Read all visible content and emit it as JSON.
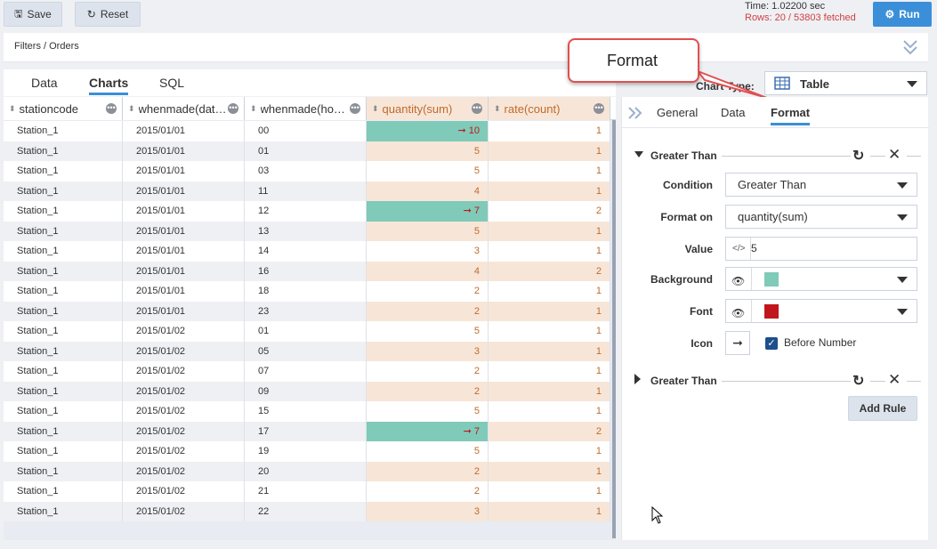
{
  "toolbar": {
    "save_label": "Save",
    "reset_label": "Reset",
    "run_label": "Run"
  },
  "status": {
    "time": "Time: 1.02200 sec",
    "rows": "Rows: 20 / 53803 fetched"
  },
  "breadcrumb": "Filters / Orders",
  "tabs": [
    "Data",
    "Charts",
    "SQL"
  ],
  "active_tab": "Charts",
  "chart_type": {
    "label": "Chart Type:",
    "value": "Table"
  },
  "callout": "Format",
  "columns": [
    "stationcode",
    "whenmade(dat…",
    "whenmade(ho…",
    "quantity(sum)",
    "rate(count)"
  ],
  "rows": [
    {
      "station": "Station_1",
      "date": "2015/01/01",
      "hour": "00",
      "qty": "10",
      "rate": "1",
      "hl": true
    },
    {
      "station": "Station_1",
      "date": "2015/01/01",
      "hour": "01",
      "qty": "5",
      "rate": "1",
      "hl": false
    },
    {
      "station": "Station_1",
      "date": "2015/01/01",
      "hour": "03",
      "qty": "5",
      "rate": "1",
      "hl": false
    },
    {
      "station": "Station_1",
      "date": "2015/01/01",
      "hour": "11",
      "qty": "4",
      "rate": "1",
      "hl": false
    },
    {
      "station": "Station_1",
      "date": "2015/01/01",
      "hour": "12",
      "qty": "7",
      "rate": "2",
      "hl": true
    },
    {
      "station": "Station_1",
      "date": "2015/01/01",
      "hour": "13",
      "qty": "5",
      "rate": "1",
      "hl": false
    },
    {
      "station": "Station_1",
      "date": "2015/01/01",
      "hour": "14",
      "qty": "3",
      "rate": "1",
      "hl": false
    },
    {
      "station": "Station_1",
      "date": "2015/01/01",
      "hour": "16",
      "qty": "4",
      "rate": "2",
      "hl": false
    },
    {
      "station": "Station_1",
      "date": "2015/01/01",
      "hour": "18",
      "qty": "2",
      "rate": "1",
      "hl": false
    },
    {
      "station": "Station_1",
      "date": "2015/01/01",
      "hour": "23",
      "qty": "2",
      "rate": "1",
      "hl": false
    },
    {
      "station": "Station_1",
      "date": "2015/01/02",
      "hour": "01",
      "qty": "5",
      "rate": "1",
      "hl": false
    },
    {
      "station": "Station_1",
      "date": "2015/01/02",
      "hour": "05",
      "qty": "3",
      "rate": "1",
      "hl": false
    },
    {
      "station": "Station_1",
      "date": "2015/01/02",
      "hour": "07",
      "qty": "2",
      "rate": "1",
      "hl": false
    },
    {
      "station": "Station_1",
      "date": "2015/01/02",
      "hour": "09",
      "qty": "2",
      "rate": "1",
      "hl": false
    },
    {
      "station": "Station_1",
      "date": "2015/01/02",
      "hour": "15",
      "qty": "5",
      "rate": "1",
      "hl": false
    },
    {
      "station": "Station_1",
      "date": "2015/01/02",
      "hour": "17",
      "qty": "7",
      "rate": "2",
      "hl": true
    },
    {
      "station": "Station_1",
      "date": "2015/01/02",
      "hour": "19",
      "qty": "5",
      "rate": "1",
      "hl": false
    },
    {
      "station": "Station_1",
      "date": "2015/01/02",
      "hour": "20",
      "qty": "2",
      "rate": "1",
      "hl": false
    },
    {
      "station": "Station_1",
      "date": "2015/01/02",
      "hour": "21",
      "qty": "2",
      "rate": "1",
      "hl": false
    },
    {
      "station": "Station_1",
      "date": "2015/01/02",
      "hour": "22",
      "qty": "3",
      "rate": "1",
      "hl": false
    }
  ],
  "panel": {
    "tabs": [
      "General",
      "Data",
      "Format"
    ],
    "active_tab": "Format",
    "rule1": {
      "title": "Greater Than"
    },
    "condition": {
      "label": "Condition",
      "value": "Greater Than"
    },
    "format_on": {
      "label": "Format on",
      "value": "quantity(sum)"
    },
    "value": {
      "label": "Value",
      "value": "5"
    },
    "background": {
      "label": "Background",
      "color": "#7fcab8"
    },
    "font": {
      "label": "Font",
      "color": "#c0171c"
    },
    "icon": {
      "label": "Icon",
      "checkbox_label": "Before Number",
      "checked": true
    },
    "rule2": {
      "title": "Greater Than"
    },
    "add_rule_label": "Add Rule"
  },
  "colors": {
    "highlight": "#7fcab8",
    "highlight_text": "#c0171c",
    "accent": "#3b8fd8",
    "num_text": "#c06a2a"
  }
}
